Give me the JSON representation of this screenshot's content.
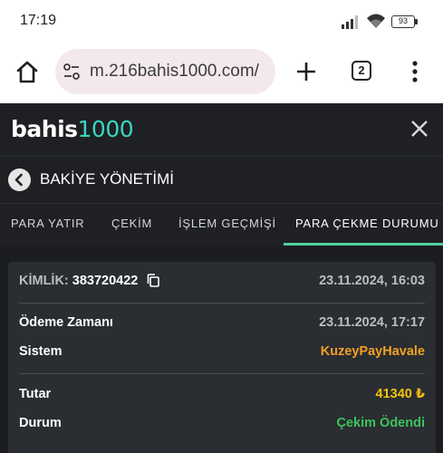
{
  "status_bar": {
    "time": "17:19",
    "battery": "93",
    "icons": [
      "signal-icon",
      "wifi-icon",
      "battery-icon"
    ]
  },
  "browser": {
    "url": "m.216bahis1000.com/",
    "tab_count": "2",
    "icons": [
      "home-icon",
      "site-settings-icon",
      "plus-icon",
      "more-vert-icon"
    ]
  },
  "site": {
    "logo_prefix": "bahis",
    "logo_suffix": "1000",
    "brand_color": "#3ad6c0"
  },
  "page": {
    "title": "BAKİYE YÖNETİMİ"
  },
  "tabs": [
    {
      "label": "PARA YATIR",
      "active": false
    },
    {
      "label": "ÇEKİM",
      "active": false
    },
    {
      "label": "İŞLEM GEÇMİŞİ",
      "active": false
    },
    {
      "label": "PARA ÇEKME DURUMU",
      "active": true
    }
  ],
  "transaction": {
    "id_label": "KİMLİK:",
    "id_value": "383720422",
    "created_at": "23.11.2024, 16:03",
    "payment_time_label": "Ödeme Zamanı",
    "payment_time_value": "23.11.2024, 17:17",
    "system_label": "Sistem",
    "system_value": "KuzeyPayHavale",
    "amount_label": "Tutar",
    "amount_value": "41340 ₺",
    "status_label": "Durum",
    "status_value": "Çekim Ödendi"
  },
  "colors": {
    "accent_green": "#4fcf9e",
    "system_orange": "#f1a127",
    "amount_yellow": "#f6c30a",
    "status_green": "#3bc45c"
  }
}
